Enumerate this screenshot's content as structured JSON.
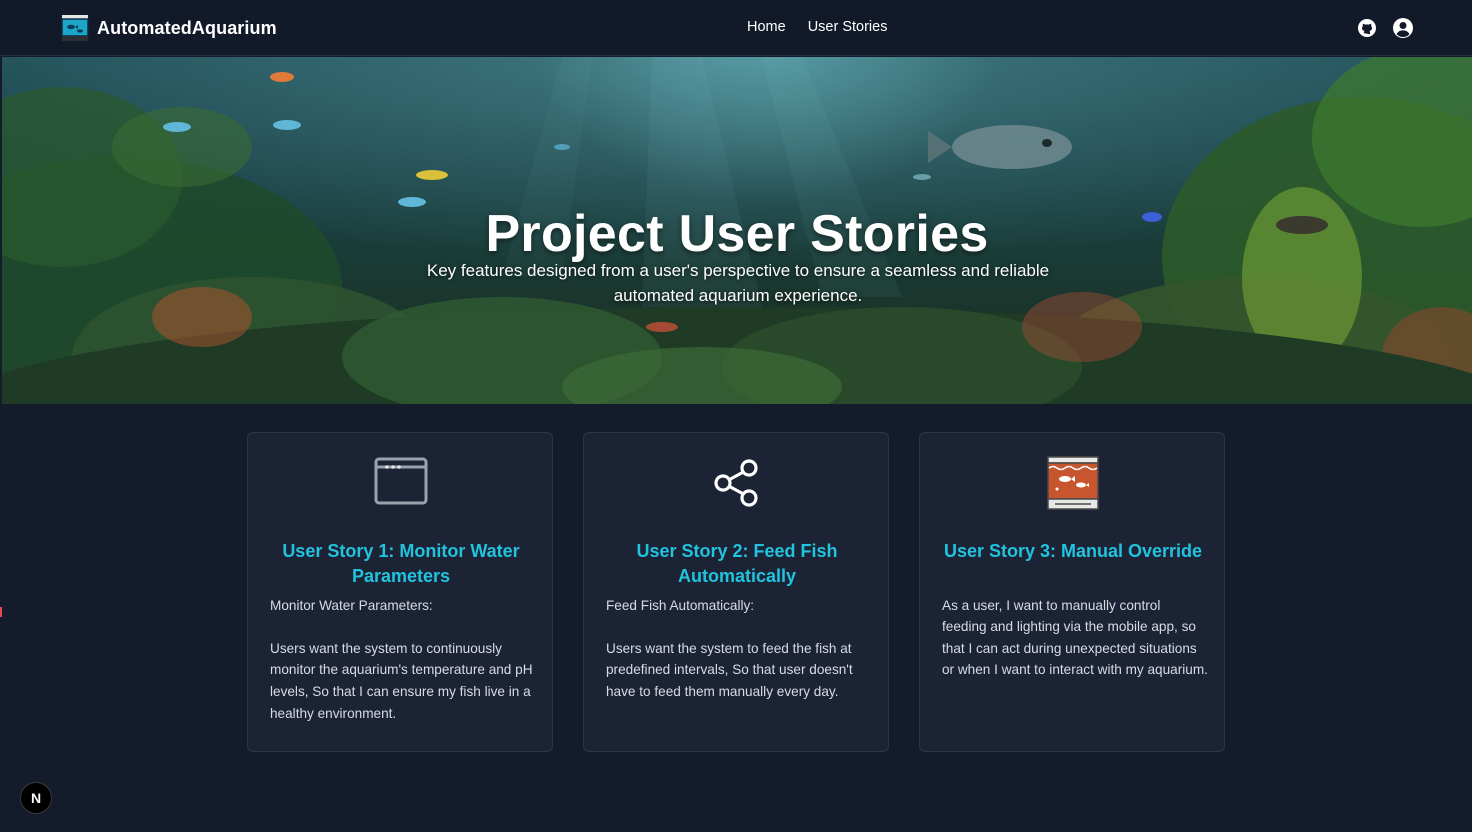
{
  "app": {
    "brand": "AutomatedAquarium"
  },
  "nav": {
    "links": [
      {
        "label": "Home"
      },
      {
        "label": "User Stories"
      }
    ]
  },
  "hero": {
    "title": "Project User Stories",
    "subtitle": "Key features designed from a user's perspective to ensure a seamless and reliable automated aquarium experience."
  },
  "stories": [
    {
      "icon": "browser-window-icon",
      "title": "User Story 1: Monitor Water Parameters",
      "body": "Monitor Water Parameters:\n\nUsers want the system to continuously monitor the aquarium's temperature and pH levels, So that I can ensure my fish live in a healthy environment."
    },
    {
      "icon": "share-nodes-icon",
      "title": "User Story 2: Feed Fish Automatically",
      "body": "Feed Fish Automatically:\n\nUsers want the system to feed the fish at predefined intervals, So that user doesn't have to feed them manually every day."
    },
    {
      "icon": "aquarium-tank-icon",
      "title": "User Story 3: Manual Override",
      "body": "As a user, I want to manually control feeding and lighting via the mobile app, so that I can act during unexpected situations or when I want to interact with my aquarium."
    }
  ],
  "badge": {
    "label": "N"
  },
  "colors": {
    "background": "#141b2b",
    "navbar": "#121a2a",
    "card": "#1b2334",
    "accent": "#22c3df"
  }
}
